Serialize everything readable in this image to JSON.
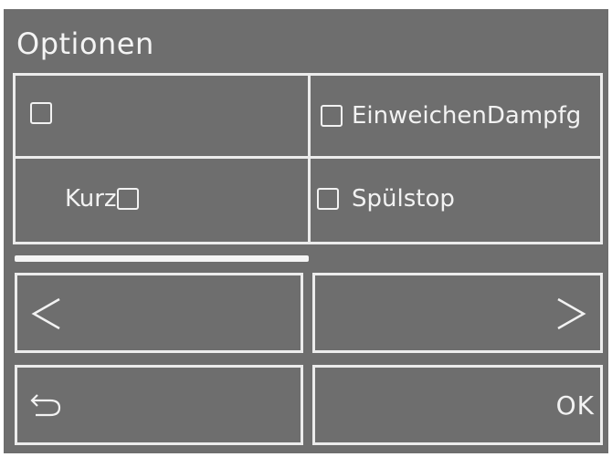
{
  "screen": {
    "title": "Optionen"
  },
  "options": [
    {
      "label": "",
      "checked": false
    },
    {
      "label": "EinweichenDampfg",
      "checked": false
    },
    {
      "label": "Kurz",
      "checked": false
    },
    {
      "label": "Spülstop",
      "checked": false
    }
  ],
  "navigation": {
    "prev_icon": "chevron-left-icon",
    "next_icon": "chevron-right-icon",
    "back_icon": "return-arrow-icon",
    "ok_label": "OK"
  },
  "colors": {
    "background": "#6e6e6e",
    "foreground": "#f2f2f2"
  }
}
